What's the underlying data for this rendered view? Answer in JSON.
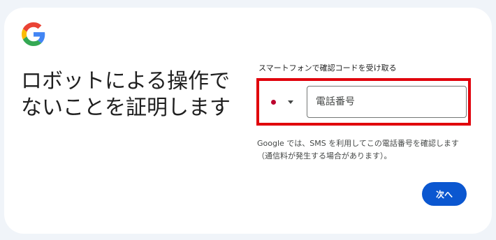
{
  "page": {
    "title": "ロボットによる操作で\nないことを証明します"
  },
  "sms": {
    "label": "スマートフォンで確認コードを受け取る",
    "phone_placeholder": "電話番号",
    "phone_value": ""
  },
  "country": {
    "flag_icon": "japan-flag-icon",
    "dropdown_icon": "chevron-down-icon"
  },
  "notice": {
    "text": "Google では、SMS を利用してこの電話番号を確認します（通信料が発生する場合があります）。"
  },
  "actions": {
    "next_label": "次へ"
  },
  "colors": {
    "primary": "#0b57d0",
    "highlight": "#e0000b",
    "background": "#f0f4f9"
  }
}
